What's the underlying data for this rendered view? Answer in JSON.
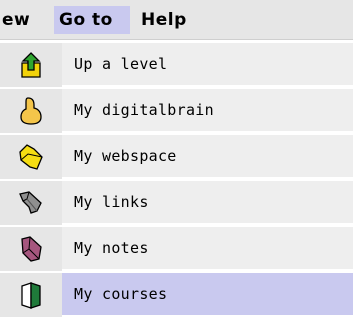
{
  "menubar": {
    "items": [
      {
        "label": "ew"
      },
      {
        "label": "Go to"
      },
      {
        "label": "Help"
      }
    ]
  },
  "menu": {
    "items": [
      {
        "label": "Up a level",
        "icon": "up-level-icon"
      },
      {
        "label": "My digitalbrain",
        "icon": "brain-icon"
      },
      {
        "label": "My webspace",
        "icon": "folder-icon"
      },
      {
        "label": "My links",
        "icon": "links-icon"
      },
      {
        "label": "My notes",
        "icon": "notes-icon"
      },
      {
        "label": "My courses",
        "icon": "courses-icon",
        "active": true
      }
    ]
  },
  "colors": {
    "highlight": "#c9c9ef",
    "panel": "#e6e6e6",
    "row": "#eeeeee"
  }
}
